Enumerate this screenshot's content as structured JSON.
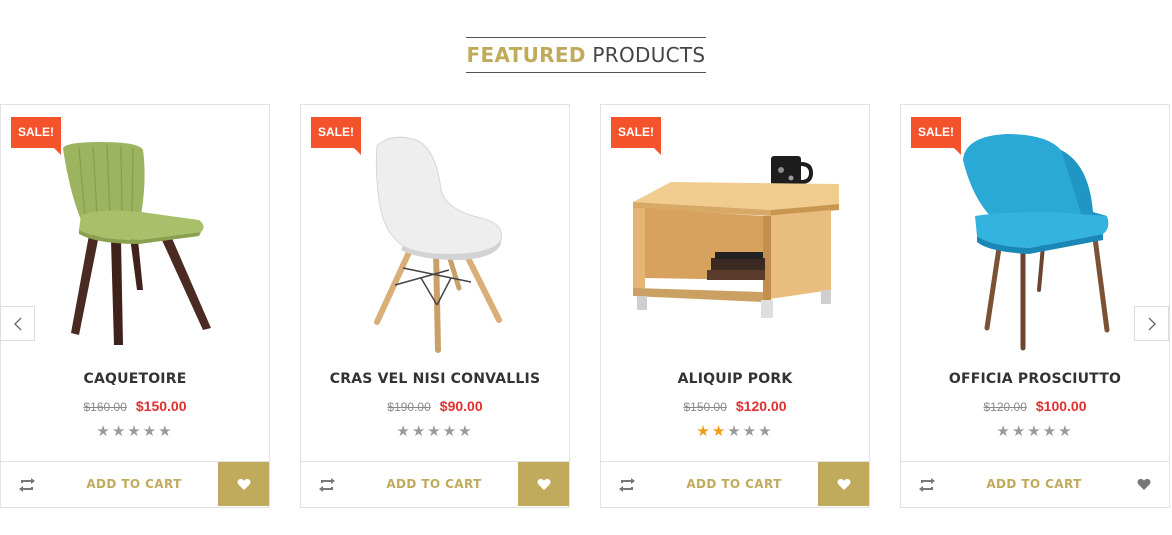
{
  "section": {
    "title_highlight": "FEATURED",
    "title_rest": " PRODUCTS"
  },
  "colors": {
    "accent": "#c0ab5c",
    "sale": "#f4522b",
    "price_new": "#e02f2f",
    "star_on": "#f29b16",
    "star_off": "#9b9b9b"
  },
  "icons": {
    "prev": "chevron-left-icon",
    "next": "chevron-right-icon",
    "compare": "compare-arrows-icon",
    "wishlist": "heart-icon"
  },
  "products": [
    {
      "badge": "SALE!",
      "name": "CAQUETOIRE",
      "old_price": "$160.00",
      "new_price": "$150.00",
      "rating": 0,
      "rating_max": 5,
      "add_to_cart": "ADD TO CART",
      "wishlist_active": true
    },
    {
      "badge": "SALE!",
      "name": "CRAS VEL NISI CONVALLIS",
      "old_price": "$190.00",
      "new_price": "$90.00",
      "rating": 0,
      "rating_max": 5,
      "add_to_cart": "ADD TO CART",
      "wishlist_active": true
    },
    {
      "badge": "SALE!",
      "name": "ALIQUIP PORK",
      "old_price": "$150.00",
      "new_price": "$120.00",
      "rating": 2,
      "rating_max": 5,
      "add_to_cart": "ADD TO CART",
      "wishlist_active": true
    },
    {
      "badge": "SALE!",
      "name": "OFFICIA PROSCIUTTO",
      "old_price": "$120.00",
      "new_price": "$100.00",
      "rating": 0,
      "rating_max": 5,
      "add_to_cart": "ADD TO CART",
      "wishlist_active": false
    }
  ]
}
